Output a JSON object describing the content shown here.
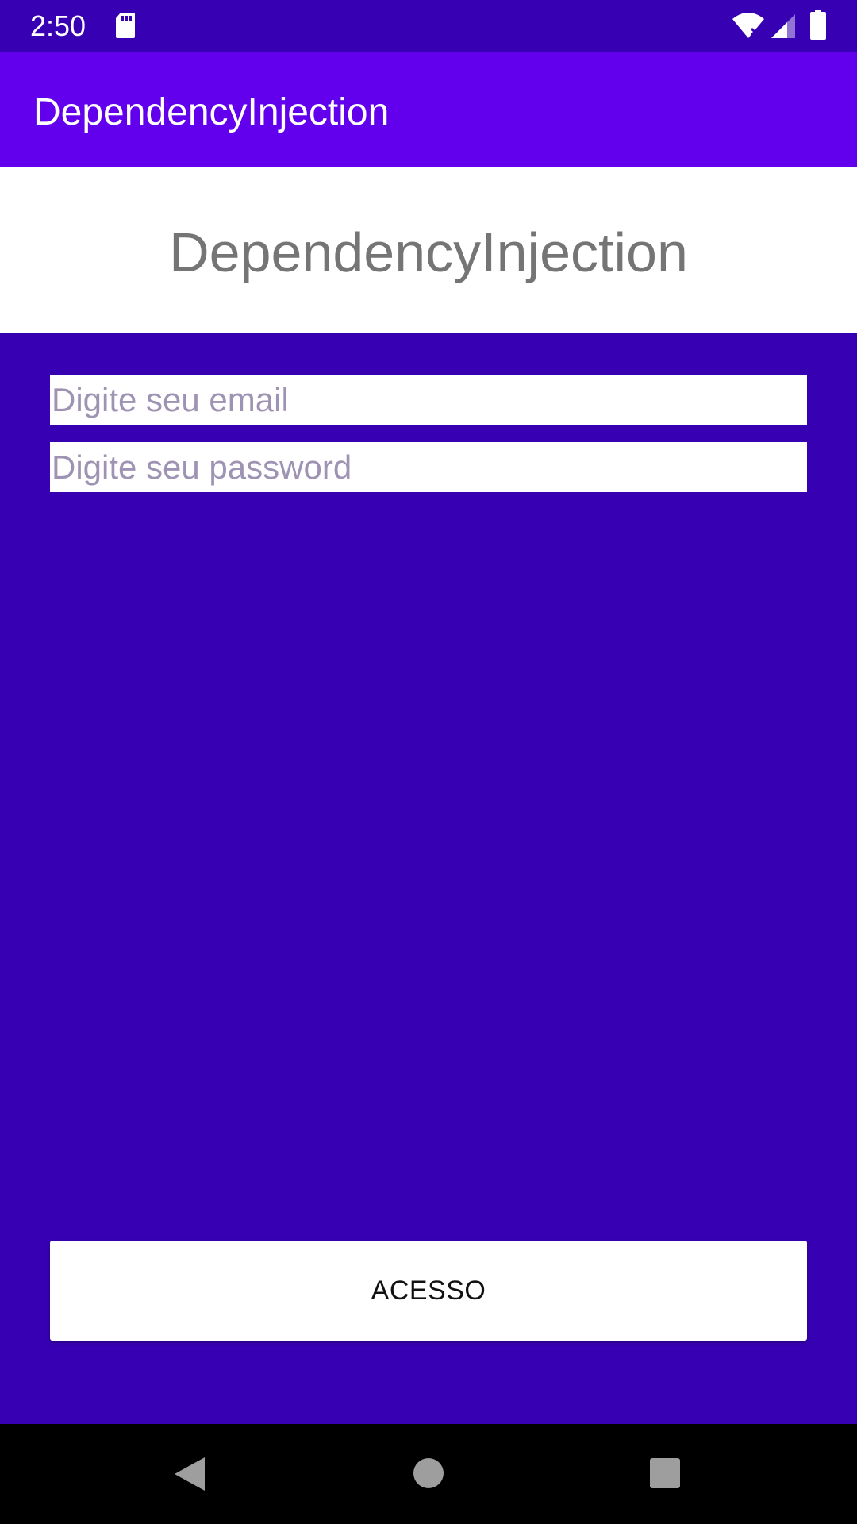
{
  "status_bar": {
    "time": "2:50",
    "icons": [
      "sd-card-icon",
      "wifi-icon",
      "cell-signal-icon",
      "battery-icon"
    ]
  },
  "app_bar": {
    "title": "DependencyInjection"
  },
  "header": {
    "title": "DependencyInjection"
  },
  "form": {
    "email_placeholder": "Digite seu email",
    "email_value": "",
    "password_placeholder": "Digite seu password",
    "password_value": "",
    "submit_label": "ACESSO"
  },
  "nav_bar": {
    "icons": [
      "back-icon",
      "home-icon",
      "recents-icon"
    ]
  },
  "colors": {
    "status_bar": "#3700B3",
    "app_bar": "#6200EE",
    "background": "#3700B3",
    "surface": "#FFFFFF",
    "header_text": "#757575",
    "nav_bar": "#000000"
  }
}
